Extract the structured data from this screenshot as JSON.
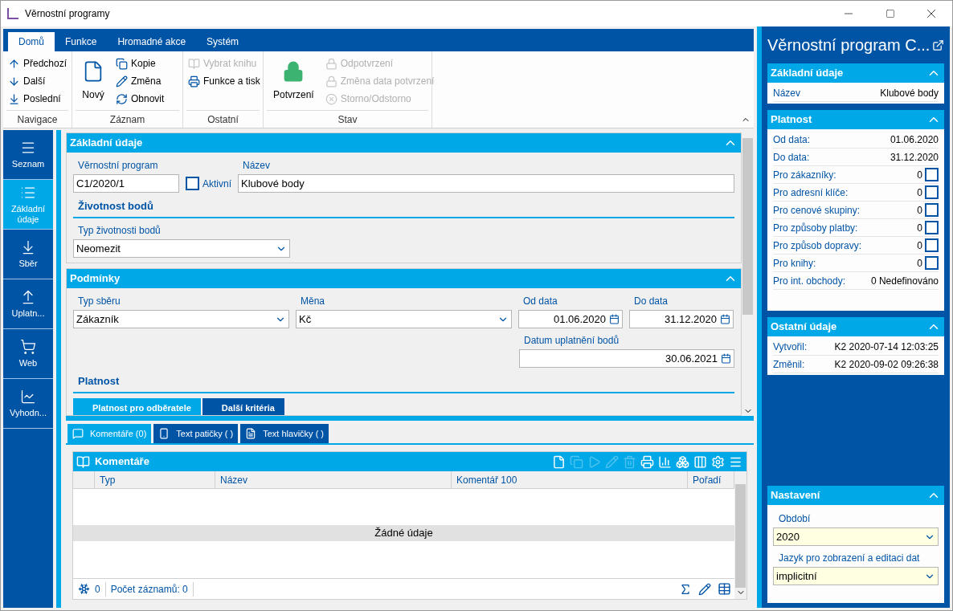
{
  "window": {
    "title": "Věrnostní programy"
  },
  "ribbon": {
    "tabs": [
      {
        "label": "Domů",
        "selected": true
      },
      {
        "label": "Funkce",
        "selected": false
      },
      {
        "label": "Hromadné akce",
        "selected": false
      },
      {
        "label": "Systém",
        "selected": false
      }
    ],
    "groups": [
      {
        "title": "Navigace",
        "items": [
          {
            "label": "Předchozí",
            "kind": "small",
            "disabled": false
          },
          {
            "label": "Další",
            "kind": "small",
            "disabled": false
          },
          {
            "label": "Poslední",
            "kind": "small",
            "disabled": false
          }
        ]
      },
      {
        "title": "Záznam",
        "items": [
          {
            "label": "Nový",
            "kind": "large",
            "disabled": false
          },
          {
            "label": "Kopie",
            "kind": "small",
            "disabled": false
          },
          {
            "label": "Změna",
            "kind": "small",
            "disabled": false
          },
          {
            "label": "Obnovit",
            "kind": "small",
            "disabled": false
          }
        ]
      },
      {
        "title": "Ostatní",
        "items": [
          {
            "label": "Vybrat knihu",
            "kind": "small",
            "disabled": true
          },
          {
            "label": "Funkce a tisk",
            "kind": "small",
            "disabled": false
          }
        ]
      },
      {
        "title": "Stav",
        "items": [
          {
            "label": "Potvrzení",
            "kind": "large",
            "disabled": false
          },
          {
            "label": "Odpotvrzení",
            "kind": "small",
            "disabled": true
          },
          {
            "label": "Změna data potvrzení",
            "kind": "small",
            "disabled": true
          },
          {
            "label": "Storno/Odstorno",
            "kind": "small",
            "disabled": true
          }
        ]
      }
    ]
  },
  "nav": [
    {
      "label": "Seznam",
      "selected": false
    },
    {
      "label": "Základní údaje",
      "selected": true
    },
    {
      "label": "Sběr",
      "selected": false
    },
    {
      "label": "Uplatn...",
      "selected": false
    },
    {
      "label": "Web",
      "selected": false
    },
    {
      "label": "Vyhodn...",
      "selected": false
    }
  ],
  "basic": {
    "title": "Základní údaje",
    "program_label": "Věrnostní program",
    "program_value": "C1/2020/1",
    "active_label": "Aktivní",
    "active_checked": false,
    "name_label": "Název",
    "name_value": "Klubové body",
    "subtitle": "Životnost bodů",
    "lifetime_label": "Typ životnosti bodů",
    "lifetime_value": "Neomezit"
  },
  "conditions": {
    "title": "Podmínky",
    "collect_label": "Typ sběru",
    "collect_value": "Zákazník",
    "currency_label": "Měna",
    "currency_value": "Kč",
    "from_label": "Od data",
    "from_value": "01.06.2020",
    "to_label": "Do data",
    "to_value": "31.12.2020",
    "redeem_label": "Datum uplatnění bodů",
    "redeem_value": "30.06.2021",
    "subtitle": "Platnost",
    "tabs": [
      {
        "label": "Platnost pro odběratele",
        "selected": true
      },
      {
        "label": "Další kritéria",
        "selected": false
      }
    ]
  },
  "bottom_tabs": [
    {
      "label": "Komentáře (0)",
      "selected": true
    },
    {
      "label": "Text patičky ( )",
      "selected": false
    },
    {
      "label": "Text hlavičky ( )",
      "selected": false
    }
  ],
  "grid": {
    "title": "Komentáře",
    "columns": [
      "Typ",
      "Název",
      "Komentář 100",
      "Pořadí"
    ],
    "empty": "Žádné údaje",
    "footer_count": "0",
    "footer_records": "Počet záznamů: 0"
  },
  "side": {
    "title": "Věrnostní program C...",
    "basic": {
      "title": "Základní údaje",
      "rows": [
        {
          "label": "Název",
          "value": "Klubové body",
          "kind": "text"
        }
      ]
    },
    "validity": {
      "title": "Platnost",
      "rows": [
        {
          "label": "Od data:",
          "value": "01.06.2020",
          "kind": "text"
        },
        {
          "label": "Do data:",
          "value": "31.12.2020",
          "kind": "text"
        },
        {
          "label": "Pro zákazníky:",
          "value": "0",
          "kind": "check",
          "checked": false
        },
        {
          "label": "Pro adresní klíče:",
          "value": "0",
          "kind": "check",
          "checked": false
        },
        {
          "label": "Pro cenové skupiny:",
          "value": "0",
          "kind": "check",
          "checked": false
        },
        {
          "label": "Pro způsoby platby:",
          "value": "0",
          "kind": "check",
          "checked": false
        },
        {
          "label": "Pro způsob dopravy:",
          "value": "0",
          "kind": "check",
          "checked": false
        },
        {
          "label": "Pro knihy:",
          "value": "0",
          "kind": "check",
          "checked": false
        },
        {
          "label": "Pro int. obchody:",
          "value": "0 Nedefinováno",
          "kind": "text"
        }
      ]
    },
    "other": {
      "title": "Ostatní údaje",
      "rows": [
        {
          "label": "Vytvořil:",
          "value": "K2 2020-07-14 12:03:25",
          "kind": "text"
        },
        {
          "label": "Změnil:",
          "value": "K2 2020-09-02 09:26:38",
          "kind": "text"
        }
      ]
    },
    "settings": {
      "title": "Nastavení",
      "fields": [
        {
          "label": "Období",
          "value": "2020"
        },
        {
          "label": "Jazyk pro zobrazení a editaci dat",
          "value": "implicitní"
        }
      ]
    }
  }
}
